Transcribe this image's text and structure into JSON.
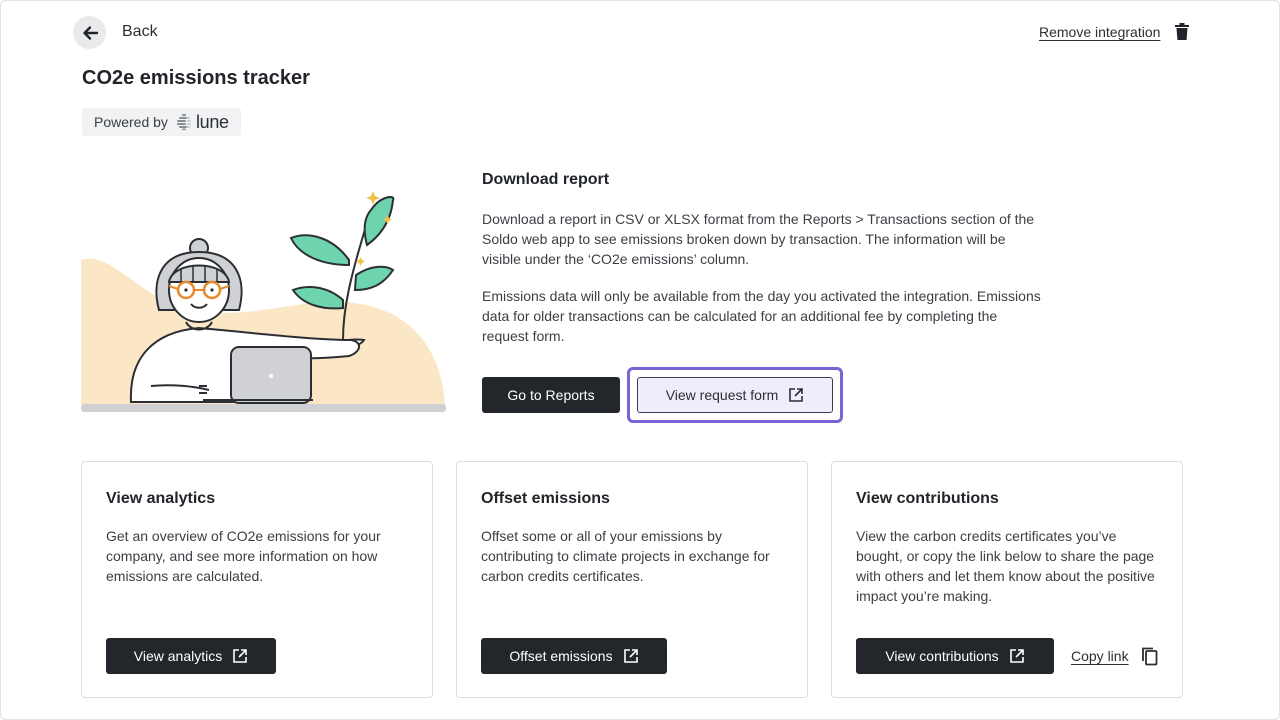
{
  "header": {
    "back_label": "Back",
    "remove_label": "Remove integration",
    "title": "CO2e emissions tracker",
    "powered_by": "Powered by",
    "brand": "lune"
  },
  "download": {
    "title": "Download report",
    "para1": "Download a report in CSV or XLSX format from the Reports > Transactions section of the Soldo web app to see emissions broken down by transaction. The information will be visible under the ‘CO2e emissions’ column.",
    "para2": "Emissions data will only be available from the day you activated the integration. Emissions data for older transactions can be calculated for an additional fee by completing the request form.",
    "reports_button": "Go to Reports",
    "request_button": "View request form"
  },
  "cards": [
    {
      "title": "View analytics",
      "text": "Get an overview of CO2e emissions for your company, and see more information on how emissions are calculated.",
      "button": "View analytics"
    },
    {
      "title": "Offset emissions",
      "text": "Offset some or all of your emissions by contributing to climate projects in exchange for carbon credits certificates.",
      "button": "Offset emissions"
    },
    {
      "title": "View contributions",
      "text": "View the carbon credits certificates you’ve bought, or copy the link below to share the page with others and let them know about the positive impact you’re making.",
      "button": "View contributions",
      "copy_link": "Copy link"
    }
  ],
  "icons": {
    "back": "arrow-left-icon",
    "remove": "trash-icon",
    "external": "external-link-icon",
    "copy": "copy-icon"
  },
  "colors": {
    "primary_button": "#23272b",
    "focus_ring": "#7b61d6",
    "secondary_button_bg": "#efedfb",
    "illustration_bg": "#fbe7c6",
    "leaf": "#6ed4ad"
  }
}
